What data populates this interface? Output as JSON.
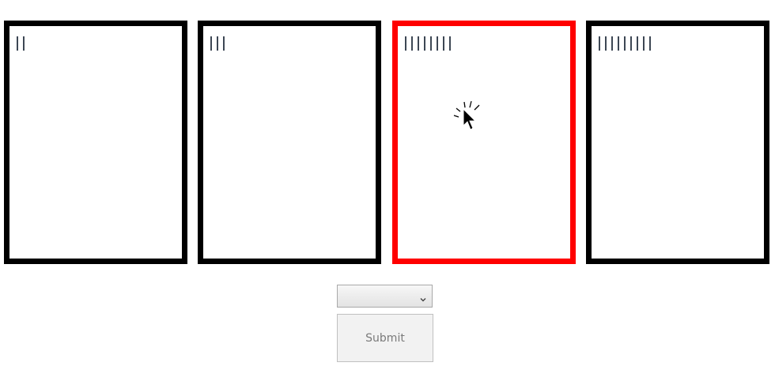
{
  "cards": [
    {
      "id": "card-1",
      "tick_count": 2,
      "selected": false
    },
    {
      "id": "card-2",
      "tick_count": 3,
      "selected": false
    },
    {
      "id": "card-3",
      "tick_count": 8,
      "selected": true
    },
    {
      "id": "card-4",
      "tick_count": 9,
      "selected": false
    }
  ],
  "dropdown": {
    "selected_value": "",
    "icon": "chevron-down-icon"
  },
  "submit": {
    "label": "Submit"
  },
  "colors": {
    "card_border": "#000000",
    "selected_border": "#ff0000",
    "tick": "#3d4754"
  },
  "cursor": {
    "icon": "click-cursor-icon"
  }
}
